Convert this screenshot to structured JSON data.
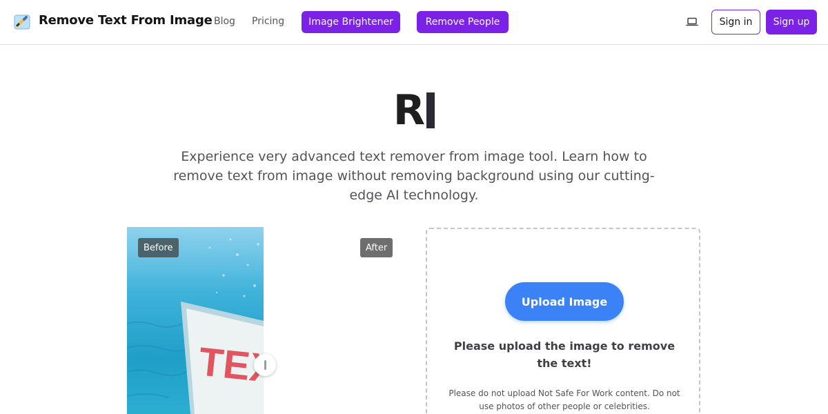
{
  "header": {
    "brand": "Remove Text From Image",
    "nav": {
      "blog": "Blog",
      "pricing": "Pricing"
    },
    "pills": {
      "image_brightener": "Image Brightener",
      "remove_people": "Remove People"
    },
    "sign_in": "Sign in",
    "sign_up": "Sign up",
    "icons": {
      "logo": "pencil-eraser-logo-icon",
      "theme": "laptop-icon"
    }
  },
  "hero": {
    "title": "R",
    "subtitle": "Experience very advanced text remover from image tool. Learn how to remove text from image without removing background using our cutting-edge AI technology."
  },
  "compare": {
    "before_label": "Before",
    "after_label": "After",
    "sign_text": "TEX",
    "handle_position": 0.5
  },
  "upload": {
    "button": "Upload Image",
    "message": "Please upload the image to remove the text!",
    "note": "Please do not upload Not Safe For Work content. Do not use photos of other people or celebrities."
  },
  "colors": {
    "accent_purple": "#7c22e6",
    "upload_blue": "#3b82f6",
    "text_dark": "#1f1f1f",
    "text_muted": "#52525b"
  }
}
